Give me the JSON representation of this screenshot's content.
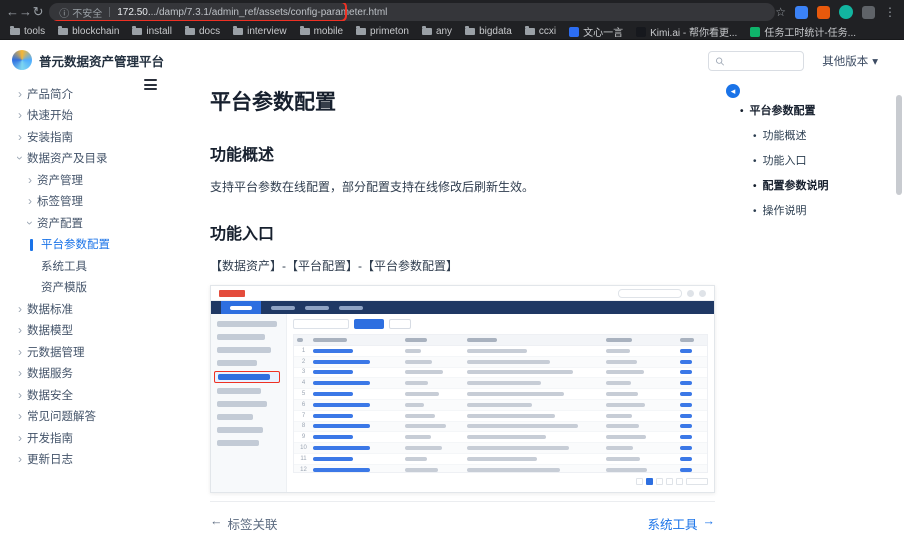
{
  "icons": {
    "back": "←",
    "forward": "→",
    "reload": "↻",
    "info": "ⓘ",
    "star": "☆",
    "kebab": "⋮",
    "chevron": "›",
    "dropdown": "▾",
    "bullet": "•",
    "arrow_left": "←",
    "arrow_right": "→",
    "toc_button": "◂"
  },
  "browser": {
    "badge": "不安全",
    "url_host": "172.50.",
    "url_path": "../damp/7.3.1/admin_ref/assets/config-parameter.html",
    "bookmarks": [
      {
        "label": "tools",
        "icon": "folder"
      },
      {
        "label": "blockchain",
        "icon": "folder"
      },
      {
        "label": "install",
        "icon": "folder"
      },
      {
        "label": "docs",
        "icon": "folder"
      },
      {
        "label": "interview",
        "icon": "folder"
      },
      {
        "label": "mobile",
        "icon": "folder"
      },
      {
        "label": "primeton",
        "icon": "folder"
      },
      {
        "label": "any",
        "icon": "folder"
      },
      {
        "label": "bigdata",
        "icon": "folder"
      },
      {
        "label": "ccxi",
        "icon": "folder"
      },
      {
        "label": "文心一言",
        "icon": "fav-blue"
      },
      {
        "label": "Kimi.ai - 帮你看更...",
        "icon": "fav-dark"
      },
      {
        "label": "任务工时统计-任务...",
        "icon": "fav-green"
      }
    ]
  },
  "sidebar": {
    "logo_title": "普元数据资产管理平台",
    "items": [
      {
        "label": "产品简介",
        "level": 1,
        "chev": "right"
      },
      {
        "label": "快速开始",
        "level": 1,
        "chev": "right"
      },
      {
        "label": "安装指南",
        "level": 1,
        "chev": "right"
      },
      {
        "label": "数据资产及目录",
        "level": 1,
        "chev": "down"
      },
      {
        "label": "资产管理",
        "level": 2,
        "chev": "right"
      },
      {
        "label": "标签管理",
        "level": 2,
        "chev": "right"
      },
      {
        "label": "资产配置",
        "level": 2,
        "chev": "down"
      },
      {
        "label": "平台参数配置",
        "level": 3,
        "active": true
      },
      {
        "label": "系统工具",
        "level": 3
      },
      {
        "label": "资产模版",
        "level": 3
      },
      {
        "label": "数据标准",
        "level": 1,
        "chev": "right"
      },
      {
        "label": "数据模型",
        "level": 1,
        "chev": "right"
      },
      {
        "label": "元数据管理",
        "level": 1,
        "chev": "right"
      },
      {
        "label": "数据服务",
        "level": 1,
        "chev": "right"
      },
      {
        "label": "数据安全",
        "level": 1,
        "chev": "right"
      },
      {
        "label": "常见问题解答",
        "level": 1,
        "chev": "right"
      },
      {
        "label": "开发指南",
        "level": 1,
        "chev": "right"
      },
      {
        "label": "更新日志",
        "level": 1,
        "chev": "right"
      }
    ]
  },
  "topbar": {
    "search_placeholder": "",
    "version_label": "其他版本"
  },
  "content": {
    "title": "平台参数配置",
    "sections": [
      {
        "heading": "功能概述",
        "text": "支持平台参数在线配置，部分配置支持在线修改后刷新生效。"
      },
      {
        "heading": "功能入口",
        "text": "【数据资产】-【平台配置】-【平台参数配置】"
      }
    ],
    "prev_label": "标签关联",
    "next_label": "系统工具"
  },
  "toc": {
    "items": [
      {
        "label": "平台参数配置",
        "level": 1,
        "bold": true
      },
      {
        "label": "功能概述",
        "level": 2,
        "bold": false
      },
      {
        "label": "功能入口",
        "level": 2,
        "bold": false
      },
      {
        "label": "配置参数说明",
        "level": 2,
        "bold": true
      },
      {
        "label": "操作说明",
        "level": 2,
        "bold": false
      }
    ]
  }
}
